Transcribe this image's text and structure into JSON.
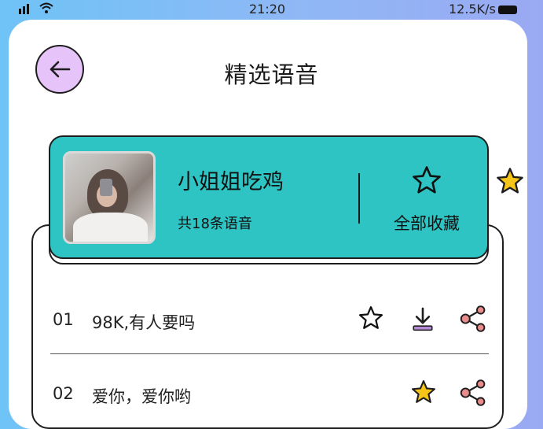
{
  "status_bar": {
    "time": "21:20",
    "speed": "12.5K/s"
  },
  "header": {
    "title": "精选语音"
  },
  "artist": {
    "name": "小姐姐吃鸡",
    "count_text": "共18条语音",
    "collect_all_label": "全部收藏"
  },
  "tracks": [
    {
      "num": "01",
      "title": "98K,有人要吗",
      "starred": false,
      "downloadable": true
    },
    {
      "num": "02",
      "title": "爱你，爱你哟",
      "starred": true,
      "downloadable": false
    }
  ],
  "colors": {
    "accent": "#2ec4c4",
    "back_button": "#e6c3f8",
    "star_filled": "#f5c518",
    "download": "#b48ad6",
    "share": "#e88b8b"
  }
}
